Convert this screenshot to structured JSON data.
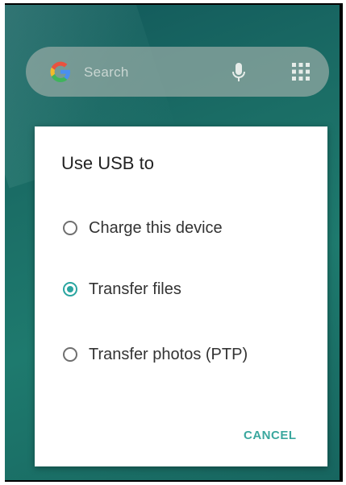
{
  "home": {
    "search_placeholder": "Search"
  },
  "icons": {
    "google": "google-g-icon",
    "mic": "mic-icon",
    "apps": "app-drawer-icon"
  },
  "dialog": {
    "title": "Use USB to",
    "options": [
      {
        "label": "Charge this device",
        "checked": false
      },
      {
        "label": "Transfer files",
        "checked": true
      },
      {
        "label": "Transfer photos (PTP)",
        "checked": false
      }
    ],
    "cancel_label": "CANCEL"
  },
  "colors": {
    "accent": "#2aa5a0",
    "wallpaper": "#1b6e66"
  }
}
